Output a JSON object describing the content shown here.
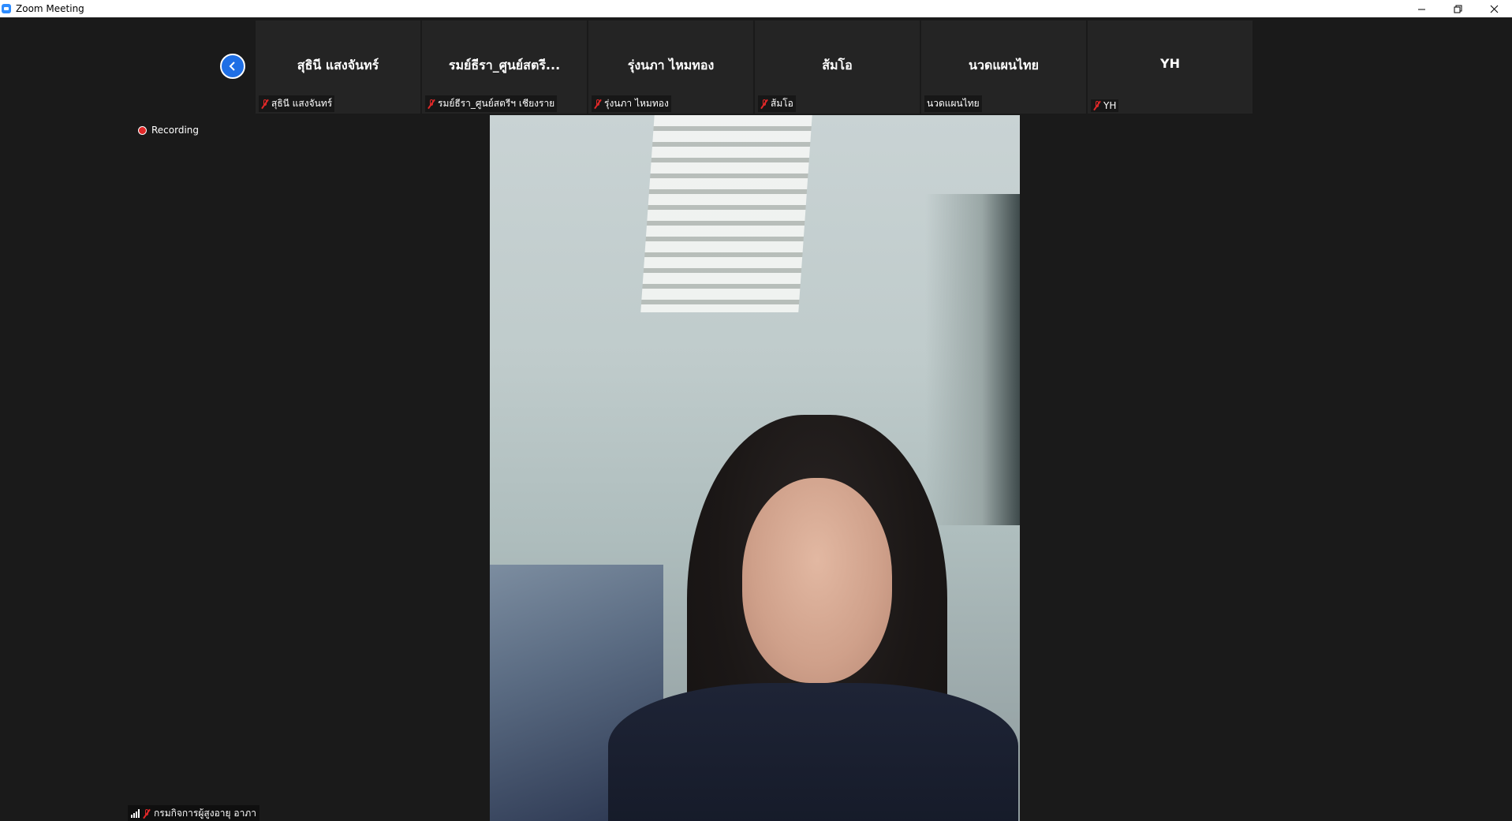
{
  "window": {
    "title": "Zoom Meeting",
    "minimize_glyph": "—",
    "restore_glyph": "❐",
    "close_glyph": "✕"
  },
  "recording": {
    "label": "Recording"
  },
  "participants": [
    {
      "display_name": "สุธินี แสงจันทร์",
      "label": "สุธินี แสงจันทร์",
      "muted": true
    },
    {
      "display_name": "รมย์ธีรา_ศูนย์สตรี...",
      "label": "รมย์ธีรา_ศูนย์สตรีฯ เชียงราย",
      "muted": true
    },
    {
      "display_name": "รุ่งนภา ไหมทอง",
      "label": "รุ่งนภา ไหมทอง",
      "muted": true
    },
    {
      "display_name": "ส้มโอ",
      "label": "ส้มโอ",
      "muted": true
    },
    {
      "display_name": "นวดแผนไทย",
      "label": "นวดแผนไทย",
      "muted": false
    },
    {
      "display_name": "YH",
      "label": "YH",
      "muted": true
    }
  ],
  "active_speaker": {
    "label": "กรมกิจการผู้สูงอายุ อาภา",
    "muted": true
  },
  "colors": {
    "accent": "#2D8CFF",
    "muted_red": "#E02828",
    "background": "#1A1A1A",
    "tile": "#242424"
  },
  "icons": {
    "collapse": "chevron-left-icon",
    "recording": "record-dot-icon",
    "mic": "mic-muted-icon",
    "signal": "signal-bars-icon"
  }
}
